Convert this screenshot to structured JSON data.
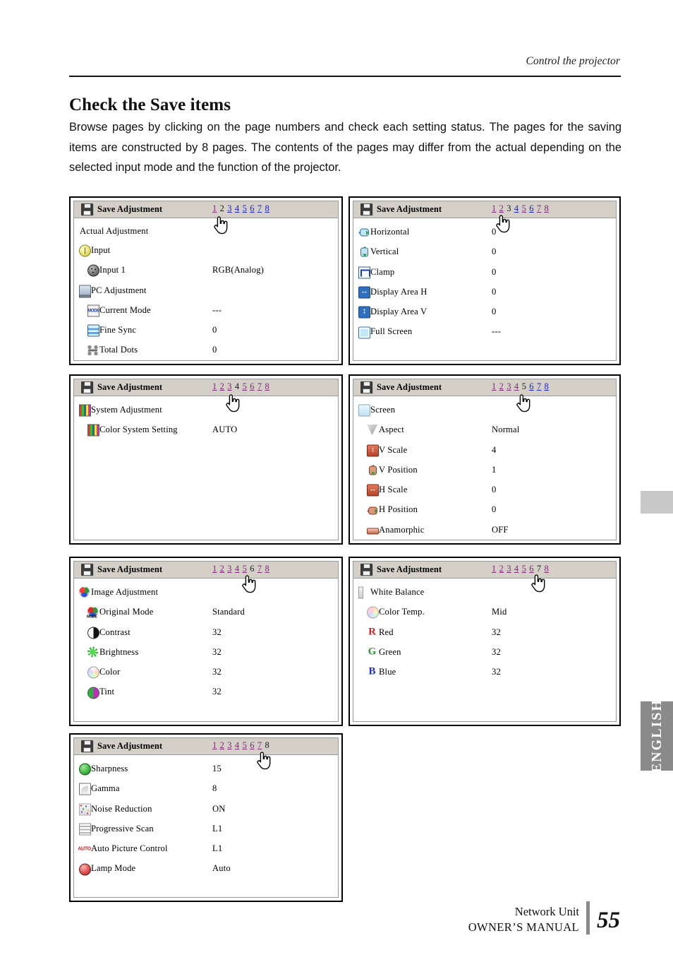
{
  "running_head": "Control the projector",
  "section": {
    "title": "Check the Save items",
    "body": "Browse pages by clicking on the page numbers and check each setting status. The pages for the saving items are constructed by 8 pages. The contents of the pages may differ from the actual depending on the selected input mode and the function of the projector."
  },
  "panel_title": "Save Adjustment",
  "pager_pages": [
    "1",
    "2",
    "3",
    "4",
    "5",
    "6",
    "7",
    "8"
  ],
  "panels": [
    {
      "name": "panel-page-2",
      "title": "Save Adjustment",
      "pager": [
        {
          "n": "1",
          "state": "visited"
        },
        {
          "n": "2",
          "state": "current"
        },
        {
          "n": "3",
          "state": "link"
        },
        {
          "n": "4",
          "state": "link"
        },
        {
          "n": "5",
          "state": "link"
        },
        {
          "n": "6",
          "state": "link"
        },
        {
          "n": "7",
          "state": "link"
        },
        {
          "n": "8",
          "state": "link"
        }
      ],
      "rows": [
        {
          "label": "Actual Adjustment",
          "value": "",
          "icon": "none",
          "level": 0,
          "plain": true
        },
        {
          "label": "Input",
          "value": "",
          "icon": "power-icon",
          "level": 0
        },
        {
          "label": "Input 1",
          "value": "RGB(Analog)",
          "icon": "din-connector-icon",
          "level": 1
        },
        {
          "label": "PC Adjustment",
          "value": "",
          "icon": "computer-icon",
          "level": 0
        },
        {
          "label": "Current Mode",
          "value": "---",
          "icon": "mode-icon",
          "level": 1
        },
        {
          "label": "Fine Sync",
          "value": "0",
          "icon": "fine-sync-icon",
          "level": 1
        },
        {
          "label": "Total Dots",
          "value": "0",
          "icon": "total-dots-icon",
          "level": 1
        }
      ]
    },
    {
      "name": "panel-page-3",
      "title": "Save Adjustment",
      "pager": [
        {
          "n": "1",
          "state": "visited"
        },
        {
          "n": "2",
          "state": "visited"
        },
        {
          "n": "3",
          "state": "current"
        },
        {
          "n": "4",
          "state": "link"
        },
        {
          "n": "5",
          "state": "visited"
        },
        {
          "n": "6",
          "state": "link"
        },
        {
          "n": "7",
          "state": "visited"
        },
        {
          "n": "8",
          "state": "visited"
        }
      ],
      "rows": [
        {
          "label": "Horizontal",
          "value": "0",
          "icon": "horizontal-icon",
          "level": 0
        },
        {
          "label": "Vertical",
          "value": "0",
          "icon": "vertical-icon",
          "level": 0
        },
        {
          "label": "Clamp",
          "value": "0",
          "icon": "clamp-icon",
          "level": 0
        },
        {
          "label": "Display Area H",
          "value": "0",
          "icon": "display-area-h-icon",
          "level": 0
        },
        {
          "label": "Display Area V",
          "value": "0",
          "icon": "display-area-v-icon",
          "level": 0
        },
        {
          "label": "Full Screen",
          "value": "---",
          "icon": "full-screen-icon",
          "level": 0
        }
      ]
    },
    {
      "name": "panel-page-4",
      "title": "Save Adjustment",
      "pager": [
        {
          "n": "1",
          "state": "visited"
        },
        {
          "n": "2",
          "state": "visited"
        },
        {
          "n": "3",
          "state": "visited"
        },
        {
          "n": "4",
          "state": "current"
        },
        {
          "n": "5",
          "state": "visited"
        },
        {
          "n": "6",
          "state": "visited"
        },
        {
          "n": "7",
          "state": "visited"
        },
        {
          "n": "8",
          "state": "visited"
        }
      ],
      "rows": [
        {
          "label": "System Adjustment",
          "value": "",
          "icon": "color-bars-icon",
          "level": 0
        },
        {
          "label": "Color System Setting",
          "value": "AUTO",
          "icon": "color-bars-icon",
          "level": 1
        }
      ]
    },
    {
      "name": "panel-page-5",
      "title": "Save Adjustment",
      "pager": [
        {
          "n": "1",
          "state": "visited"
        },
        {
          "n": "2",
          "state": "visited"
        },
        {
          "n": "3",
          "state": "visited"
        },
        {
          "n": "4",
          "state": "visited"
        },
        {
          "n": "5",
          "state": "current"
        },
        {
          "n": "6",
          "state": "link"
        },
        {
          "n": "7",
          "state": "link"
        },
        {
          "n": "8",
          "state": "link"
        }
      ],
      "rows": [
        {
          "label": "Screen",
          "value": "",
          "icon": "screen-icon",
          "level": 0
        },
        {
          "label": "Aspect",
          "value": "Normal",
          "icon": "aspect-icon",
          "level": 1
        },
        {
          "label": "V Scale",
          "value": "4",
          "icon": "v-scale-icon",
          "level": 1
        },
        {
          "label": "V Position",
          "value": "1",
          "icon": "v-position-icon",
          "level": 1
        },
        {
          "label": "H Scale",
          "value": "0",
          "icon": "h-scale-icon",
          "level": 1
        },
        {
          "label": "H Position",
          "value": "0",
          "icon": "h-position-icon",
          "level": 1
        },
        {
          "label": "Anamorphic",
          "value": "OFF",
          "icon": "anamorphic-icon",
          "level": 1
        }
      ]
    },
    {
      "name": "panel-page-6",
      "title": "Save Adjustment",
      "pager": [
        {
          "n": "1",
          "state": "visited"
        },
        {
          "n": "2",
          "state": "visited"
        },
        {
          "n": "3",
          "state": "visited"
        },
        {
          "n": "4",
          "state": "visited"
        },
        {
          "n": "5",
          "state": "visited"
        },
        {
          "n": "6",
          "state": "current"
        },
        {
          "n": "7",
          "state": "visited"
        },
        {
          "n": "8",
          "state": "visited"
        }
      ],
      "rows": [
        {
          "label": "Image Adjustment",
          "value": "",
          "icon": "image-adjustment-icon",
          "level": 0
        },
        {
          "label": "Original Mode",
          "value": "Standard",
          "icon": "original-mode-icon",
          "level": 1
        },
        {
          "label": "Contrast",
          "value": "32",
          "icon": "contrast-icon",
          "level": 1
        },
        {
          "label": "Brightness",
          "value": "32",
          "icon": "brightness-icon",
          "level": 1
        },
        {
          "label": "Color",
          "value": "32",
          "icon": "color-wheel-icon",
          "level": 1
        },
        {
          "label": "Tint",
          "value": "32",
          "icon": "tint-icon",
          "level": 1
        }
      ]
    },
    {
      "name": "panel-page-7",
      "title": "Save Adjustment",
      "pager": [
        {
          "n": "1",
          "state": "visited"
        },
        {
          "n": "2",
          "state": "visited"
        },
        {
          "n": "3",
          "state": "visited"
        },
        {
          "n": "4",
          "state": "visited"
        },
        {
          "n": "5",
          "state": "visited"
        },
        {
          "n": "6",
          "state": "visited"
        },
        {
          "n": "7",
          "state": "current"
        },
        {
          "n": "8",
          "state": "visited"
        }
      ],
      "rows": [
        {
          "label": "White Balance",
          "value": "",
          "icon": "white-balance-icon",
          "level": 0
        },
        {
          "label": "Color Temp.",
          "value": "Mid",
          "icon": "color-temp-icon",
          "level": 1
        },
        {
          "label": "Red",
          "value": "32",
          "icon": "red-letter-icon",
          "level": 1
        },
        {
          "label": "Green",
          "value": "32",
          "icon": "green-letter-icon",
          "level": 1
        },
        {
          "label": "Blue",
          "value": "32",
          "icon": "blue-letter-icon",
          "level": 1
        }
      ]
    },
    {
      "name": "panel-page-8",
      "title": "Save Adjustment",
      "pager": [
        {
          "n": "1",
          "state": "visited"
        },
        {
          "n": "2",
          "state": "visited"
        },
        {
          "n": "3",
          "state": "visited"
        },
        {
          "n": "4",
          "state": "visited"
        },
        {
          "n": "5",
          "state": "visited"
        },
        {
          "n": "6",
          "state": "visited"
        },
        {
          "n": "7",
          "state": "visited"
        },
        {
          "n": "8",
          "state": "current"
        }
      ],
      "rows": [
        {
          "label": "Sharpness",
          "value": "15",
          "icon": "sharpness-icon",
          "level": 0
        },
        {
          "label": "Gamma",
          "value": "8",
          "icon": "gamma-icon",
          "level": 0
        },
        {
          "label": "Noise Reduction",
          "value": "ON",
          "icon": "noise-reduction-icon",
          "level": 0
        },
        {
          "label": "Progressive Scan",
          "value": "L1",
          "icon": "progressive-scan-icon",
          "level": 0
        },
        {
          "label": "Auto Picture Control",
          "value": "L1",
          "icon": "auto-picture-icon",
          "level": 0
        },
        {
          "label": "Lamp Mode",
          "value": "Auto",
          "icon": "lamp-mode-icon",
          "level": 0
        }
      ]
    }
  ],
  "side_tab": {
    "label": "ENGLISH"
  },
  "footer": {
    "line1": "Network Unit",
    "line2": "OWNER’S MANUAL",
    "page_number": "55"
  },
  "colors": {
    "link": "#1c22c8",
    "visited_link": "#7a2a72",
    "panel_header_bg": "#d4d0c8",
    "tab_grey": "#c8c8c8",
    "tab_english": "#8a8a8a"
  }
}
